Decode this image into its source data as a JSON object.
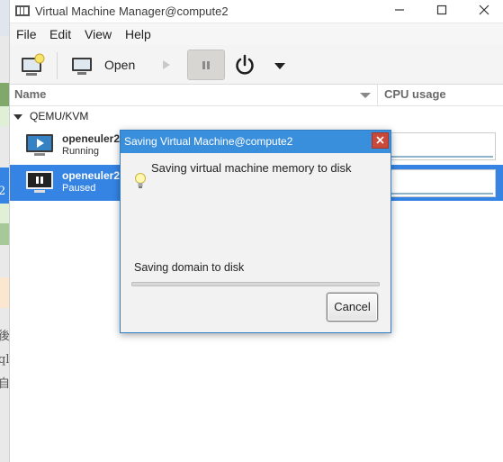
{
  "window": {
    "title": "Virtual Machine Manager@compute2"
  },
  "menu": [
    "File",
    "Edit",
    "View",
    "Help"
  ],
  "toolbar": {
    "open_label": "Open"
  },
  "columns": {
    "name": "Name",
    "cpu": "CPU usage"
  },
  "group": {
    "label": "QEMU/KVM"
  },
  "vms": [
    {
      "name": "openeuler22",
      "state": "Running"
    },
    {
      "name": "openeuler22",
      "state": "Paused"
    }
  ],
  "dialog": {
    "title": "Saving Virtual Machine@compute2",
    "message": "Saving virtual machine memory to disk",
    "status": "Saving domain to disk",
    "cancel_label": "Cancel",
    "progress": 0
  },
  "background": {
    "glyphs": [
      "2",
      "後",
      "ql",
      "自"
    ]
  },
  "colors": {
    "accent": "#3584e4",
    "dialog_title": "#3a8fdc",
    "close": "#c94a3a"
  }
}
